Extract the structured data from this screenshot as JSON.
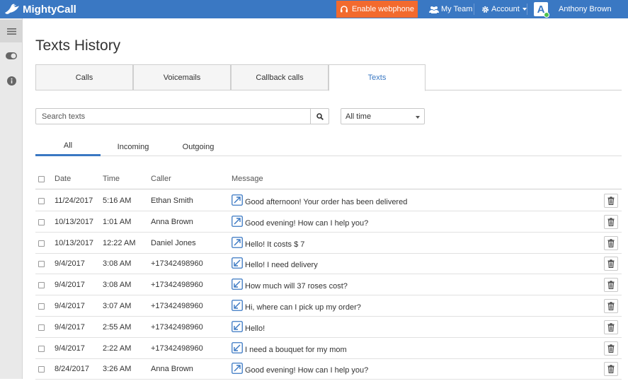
{
  "topbar": {
    "brand": "MightyCall",
    "webphone_label": "Enable webphone",
    "my_team_label": "My Team",
    "account_label": "Account",
    "avatar_letter": "A",
    "user_name": "Anthony Brown",
    "colors": {
      "bar": "#3a78c3",
      "webphone": "#f26a2e"
    }
  },
  "sidebar": {
    "items": [
      {
        "icon": "menu-icon"
      },
      {
        "icon": "toggle-icon"
      },
      {
        "icon": "info-icon"
      }
    ]
  },
  "page": {
    "title": "Texts History"
  },
  "tabs": [
    {
      "label": "Calls",
      "active": false
    },
    {
      "label": "Voicemails",
      "active": false
    },
    {
      "label": "Callback calls",
      "active": false
    },
    {
      "label": "Texts",
      "active": true
    }
  ],
  "filters": {
    "search_placeholder": "Search texts",
    "time_range": "All time"
  },
  "subtabs": [
    {
      "label": "All",
      "active": true
    },
    {
      "label": "Incoming",
      "active": false
    },
    {
      "label": "Outgoing",
      "active": false
    }
  ],
  "table": {
    "columns": {
      "date": "Date",
      "time": "Time",
      "caller": "Caller",
      "message": "Message"
    },
    "rows": [
      {
        "date": "11/24/2017",
        "time": "5:16 AM",
        "caller": "Ethan Smith",
        "direction": "outgoing",
        "message": "Good afternoon! Your order has been delivered"
      },
      {
        "date": "10/13/2017",
        "time": "1:01 AM",
        "caller": "Anna Brown",
        "direction": "outgoing",
        "message": "Good evening! How can I help you?"
      },
      {
        "date": "10/13/2017",
        "time": "12:22 AM",
        "caller": "Daniel Jones",
        "direction": "outgoing",
        "message": "Hello! It costs $ 7"
      },
      {
        "date": "9/4/2017",
        "time": "3:08 AM",
        "caller": "+17342498960",
        "direction": "incoming",
        "message": "Hello! I need delivery"
      },
      {
        "date": "9/4/2017",
        "time": "3:08 AM",
        "caller": "+17342498960",
        "direction": "incoming",
        "message": "How much will 37 roses cost?"
      },
      {
        "date": "9/4/2017",
        "time": "3:07 AM",
        "caller": "+17342498960",
        "direction": "incoming",
        "message": "Hi, where can I pick up my order?"
      },
      {
        "date": "9/4/2017",
        "time": "2:55 AM",
        "caller": "+17342498960",
        "direction": "incoming",
        "message": "Hello!"
      },
      {
        "date": "9/4/2017",
        "time": "2:22 AM",
        "caller": "+17342498960",
        "direction": "incoming",
        "message": "I need a bouquet for my mom"
      },
      {
        "date": "8/24/2017",
        "time": "3:26 AM",
        "caller": "Anna Brown",
        "direction": "outgoing",
        "message": "Good evening! How can I help you?"
      }
    ]
  }
}
